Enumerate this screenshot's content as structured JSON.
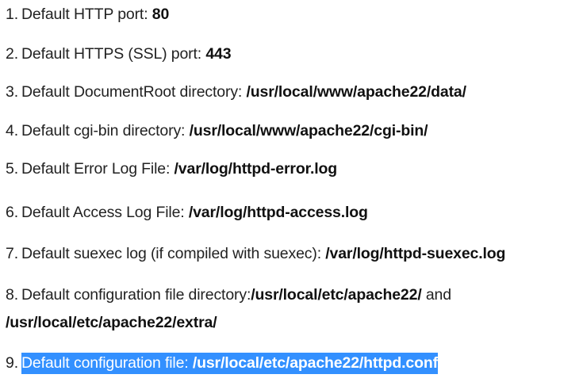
{
  "items": [
    {
      "number": "1.",
      "text": "Default HTTP port: ",
      "value": "80"
    },
    {
      "number": "2.",
      "text": "Default HTTPS (SSL) port: ",
      "value": "443"
    },
    {
      "number": "3.",
      "text": "Default DocumentRoot directory: ",
      "value": "/usr/local/www/apache22/data/"
    },
    {
      "number": "4.",
      "text": "Default cgi-bin directory: ",
      "value": "/usr/local/www/apache22/cgi-bin/"
    },
    {
      "number": "5.",
      "text": "Default Error Log File: ",
      "value": "/var/log/httpd-error.log"
    },
    {
      "number": "6.",
      "text": "Default Access Log File: ",
      "value": "/var/log/httpd-access.log"
    },
    {
      "number": "7.",
      "text": "Default suexec log (if compiled with suexec): ",
      "value": "/var/log/httpd-suexec.log"
    },
    {
      "number": "8.",
      "text": "Default configuration file directory:",
      "value": "/usr/local/etc/apache22/",
      "joiner": " and ",
      "value2": "/usr/local/etc/apache22/extra/"
    },
    {
      "number": "9.",
      "text": "Default configuration file: ",
      "value": "/usr/local/etc/apache22/httpd.conf",
      "selected": true
    }
  ],
  "colors": {
    "text": "#222222",
    "selection_background": "#3390ff",
    "selection_text": "#ffffff"
  }
}
